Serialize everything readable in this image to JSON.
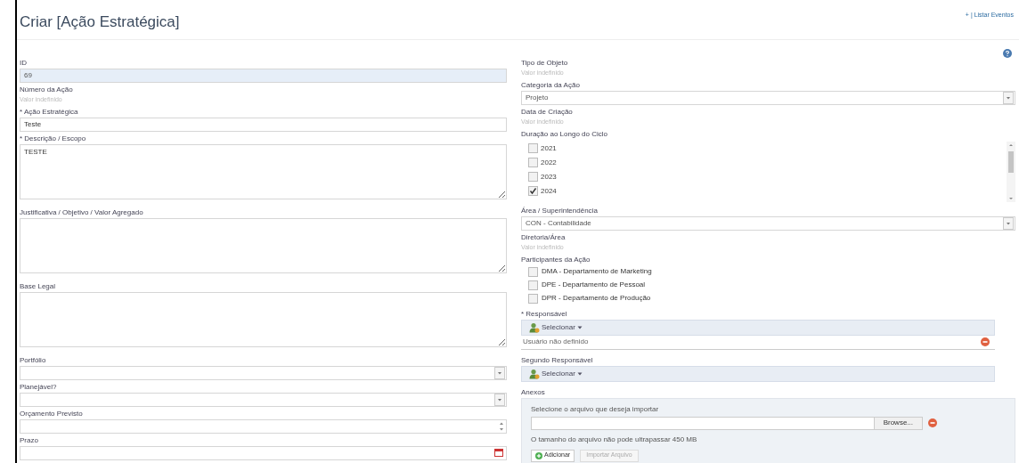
{
  "page": {
    "title": "Criar [Ação Estratégica]",
    "top_link": "+ | Listar Eventos"
  },
  "left_fields": [
    {
      "kind": "text",
      "label": "ID",
      "value": "69",
      "disabled": true
    },
    {
      "kind": "readonly",
      "label": "Número da Ação",
      "placeholder": "Valor indefinido"
    },
    {
      "kind": "text",
      "label": "* Ação Estratégica",
      "value": "Teste",
      "disabled": false
    },
    {
      "kind": "textarea",
      "label": "* Descrição / Escopo",
      "value": "TESTE"
    },
    {
      "kind": "textarea",
      "label": "Justificativa / Objetivo / Valor Agregado"
    },
    {
      "kind": "textarea",
      "label": "Base Legal"
    },
    {
      "kind": "select",
      "label": "Portfólio"
    },
    {
      "kind": "select",
      "label": "Planejável?"
    },
    {
      "kind": "number",
      "label": "Orçamento Previsto"
    },
    {
      "kind": "date",
      "label": "Prazo"
    }
  ],
  "right_fields": [
    {
      "kind": "readonly",
      "label": "Tipo de Objeto",
      "placeholder": "Valor indefinido"
    },
    {
      "kind": "select",
      "label": "Categoria da Ação",
      "value": "Projeto"
    },
    {
      "kind": "readonly",
      "label": "Data de Criação",
      "placeholder": "Valor indefinido"
    },
    {
      "kind": "checklist",
      "label": "Duração ao Longo do Ciclo",
      "options": [
        {
          "label": "2021",
          "checked": false
        },
        {
          "label": "2022",
          "checked": false
        },
        {
          "label": "2023",
          "checked": false
        },
        {
          "label": "2024",
          "checked": true
        }
      ]
    },
    {
      "kind": "select",
      "label": "Área / Superintendência",
      "value": "CON - Contabilidade"
    },
    {
      "kind": "readonly",
      "label": "Diretoria/Área",
      "placeholder": "Valor indefinido"
    },
    {
      "kind": "checkboxes",
      "label": "Participantes da Ação",
      "options": [
        {
          "label": "DMA - Departamento de Marketing",
          "checked": false
        },
        {
          "label": "DPE - Departamento de Pessoal",
          "checked": false
        },
        {
          "label": "DPR - Departamento de Produção",
          "checked": false
        }
      ]
    },
    {
      "kind": "user",
      "label": "* Responsável",
      "button": "Selecionar",
      "user": "Usuário não definido"
    },
    {
      "kind": "user",
      "label": "Segundo Responsável",
      "button": "Selecionar"
    },
    {
      "kind": "attachments",
      "label": "Anexos",
      "prompt": "Selecione o arquivo que deseja importar",
      "browse": "Browse...",
      "note": "O tamanho do arquivo não pode ultrapassar 450 MB",
      "add": "Adicionar",
      "import": "Importar Arquivo"
    }
  ]
}
